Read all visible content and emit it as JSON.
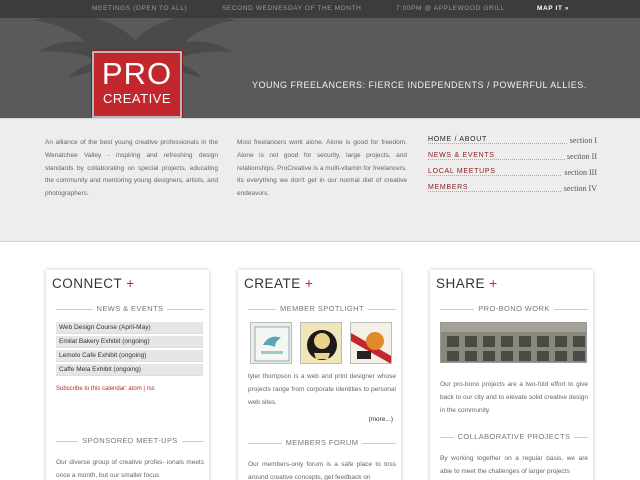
{
  "topbar": {
    "item1": "MEETINGS (OPEN TO ALL)",
    "item2": "SECOND WEDNESDAY OF THE MONTH",
    "item3": "7:00PM @ APPLEWOOD GRILL",
    "map_link": "MAP IT »"
  },
  "logo": {
    "line1": "PRO",
    "line2": "CREATIVE"
  },
  "tagline": "YOUNG FREELANCERS: FIERCE INDEPENDENTS / POWERFUL ALLIES.",
  "intro": {
    "p1": "An alliance of the best young creative professionals in the Wenatchee Valley - inspiring and refreshing design standards by collaborating on special projects, educating the community and mentoring young designers, artists, and photographers.",
    "p2": "Most freelancers work alone. Alone is good for freedom. Alone is not good for security, large projects, and relationships. ProCreative is a multi-vitamin for freelancers. Its everything we don't get in our normal diet of creative endeavors."
  },
  "nav": [
    {
      "label": "HOME / ABOUT",
      "section": "section I"
    },
    {
      "label": "NEWS & EVENTS",
      "section": "section II"
    },
    {
      "label": "LOCAL MEETUPS",
      "section": "section III"
    },
    {
      "label": "MEMBERS",
      "section": "section IV"
    }
  ],
  "connect": {
    "title": "CONNECT",
    "plus": "+",
    "news_heading": "NEWS & EVENTS",
    "events": [
      "Web Design Course (April-May)",
      "Emilat Bakery Exhibit (ongoing)",
      "Lemolo Cafe Exhibit (ongoing)",
      "Caffe Mela Exhibit (ongoing)"
    ],
    "subscribe_label": "Subscribe to this calendar:",
    "atom": "atom",
    "sep": "|",
    "rss": "rss",
    "sponsored_heading": "SPONSORED MEET-UPS",
    "sponsored_text": "Our diverse group of creative profes- ionals meets once a month, but our smaller focus"
  },
  "create": {
    "title": "CREATE",
    "plus": "+",
    "spotlight_heading": "MEMBER SPOTLIGHT",
    "spotlight_text": "tyler thompson is a web and print designer whose projects range from corporate identities to personal web sites.",
    "more": "(more...)",
    "forum_heading": "MEMBERS FORUM",
    "forum_text": "Our members-only forum is a safe place to toss around creative concepts, get feedback on"
  },
  "share": {
    "title": "SHARE",
    "plus": "+",
    "probono_heading": "PRO-BONO WORK",
    "probono_text": "Our pro-bono projects are a two-fold effort to give back to our city and to elevate solid creative design in the community.",
    "collab_heading": "COLLABORATIVE PROJECTS",
    "collab_text": "By working together on a regular basis, we are able to meet the challenges of larger projects"
  },
  "colors": {
    "accent": "#c1272d",
    "topbar": "#3c3c3c",
    "header": "#5a5a5a"
  }
}
